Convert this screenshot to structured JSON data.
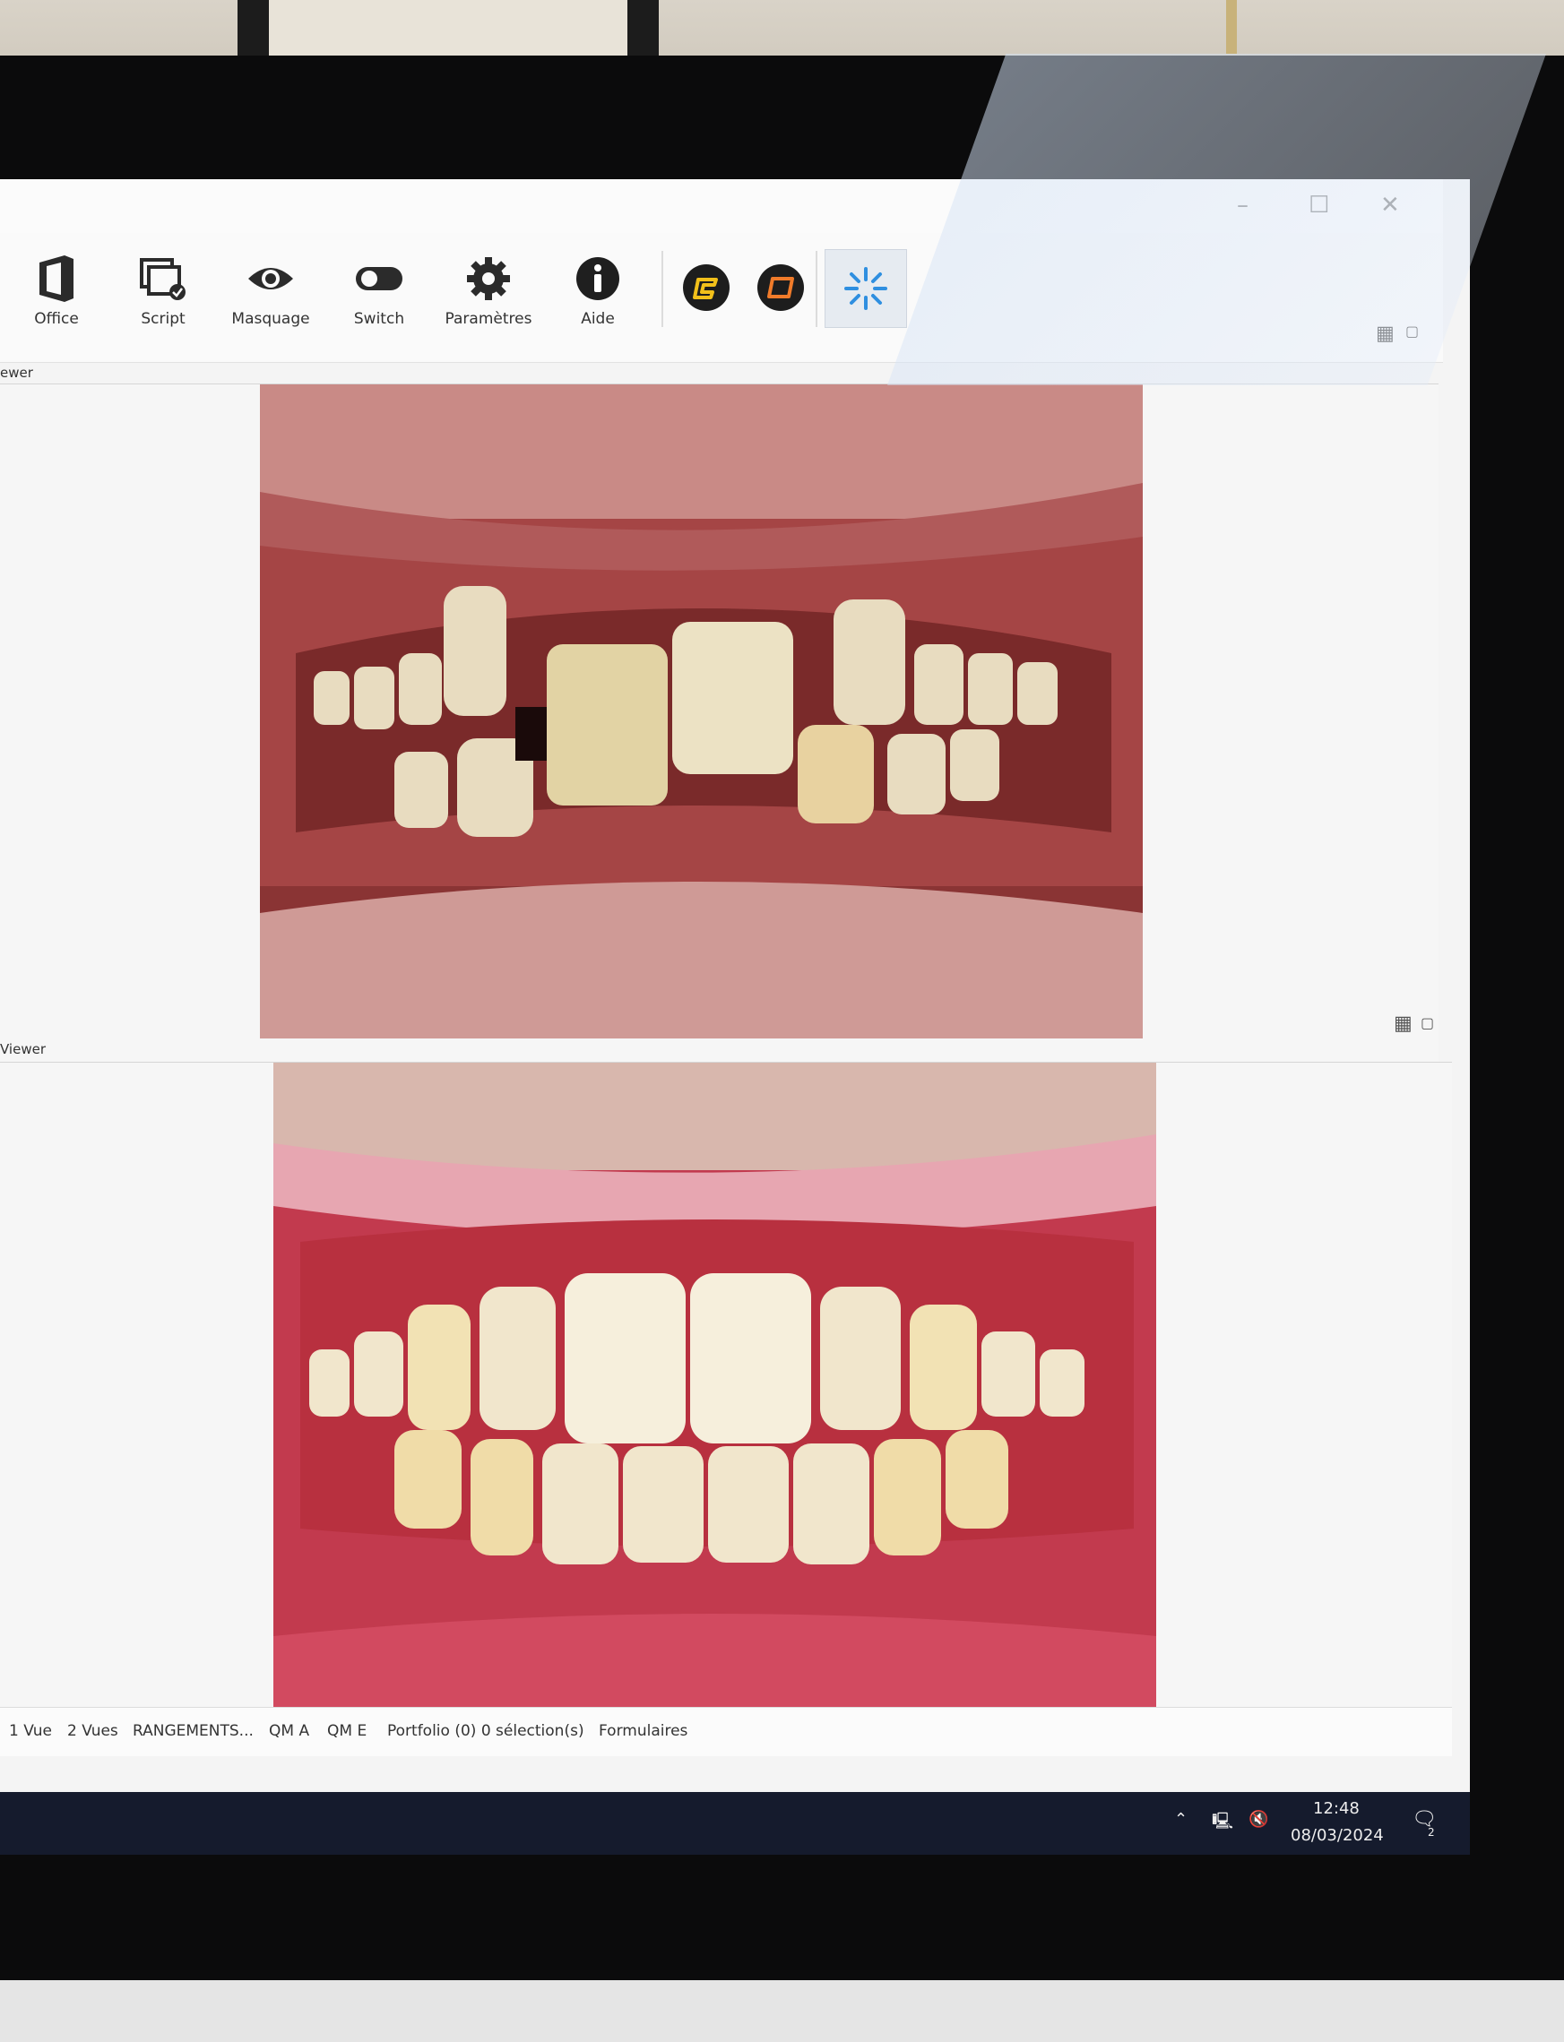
{
  "window": {
    "minimize_glyph": "–",
    "maximize_glyph": "☐",
    "close_glyph": "✕"
  },
  "toolbar": {
    "items": [
      {
        "label": "Office",
        "icon": "office-icon"
      },
      {
        "label": "Script",
        "icon": "script-icon"
      },
      {
        "label": "Masquage",
        "icon": "eye-icon"
      },
      {
        "label": "Switch",
        "icon": "toggle-icon"
      },
      {
        "label": "Paramètres",
        "icon": "gear-icon"
      },
      {
        "label": "Aide",
        "icon": "info-icon"
      }
    ],
    "accent_yellow": "#f2c01a",
    "accent_orange": "#f07b2a",
    "spark_color": "#2f8fe0"
  },
  "viewers": [
    {
      "label": "ewer",
      "photo": "before-treatment-teeth"
    },
    {
      "label": "Viewer",
      "photo": "after-treatment-teeth"
    }
  ],
  "statusbar": {
    "items": [
      "1 Vue",
      "2 Vues",
      "RANGEMENTS...",
      "QM A",
      "QM E",
      "Portfolio (0) 0 sélection(s)",
      "Formulaires"
    ]
  },
  "taskbar": {
    "time": "12:48",
    "date": "08/03/2024",
    "notifications_count": "2"
  }
}
